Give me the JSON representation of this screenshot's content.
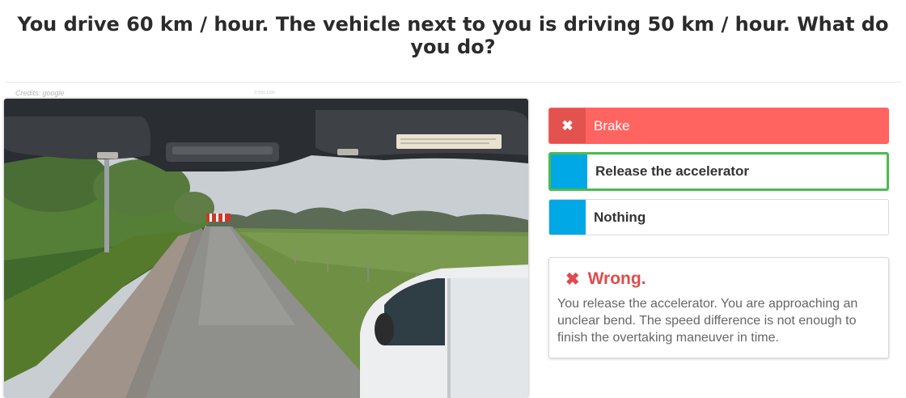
{
  "question": {
    "text": "You drive 60 km / hour. The vehicle next to you is driving 50 km / hour. What do you do?"
  },
  "image": {
    "credits": "Credits: google",
    "id_text": "37583.1196"
  },
  "answers": [
    {
      "label": "Brake",
      "state": "wrong",
      "marker_icon": "close-icon",
      "marker_glyph": "✖"
    },
    {
      "label": "Release the accelerator",
      "state": "correct",
      "marker_icon": "",
      "marker_glyph": ""
    },
    {
      "label": "Nothing",
      "state": "neutral",
      "marker_icon": "",
      "marker_glyph": ""
    }
  ],
  "feedback": {
    "icon": "close-icon",
    "icon_glyph": "✖",
    "verdict": "Wrong.",
    "explanation": "You release the accelerator. You are approaching an unclear bend. The speed difference is not enough to finish the overtaking maneuver in time."
  },
  "colors": {
    "wrong": "#ff6461",
    "correct_border": "#4cbb4f",
    "marker_blue": "#00a8e6",
    "verdict_red": "#e04b4b"
  }
}
